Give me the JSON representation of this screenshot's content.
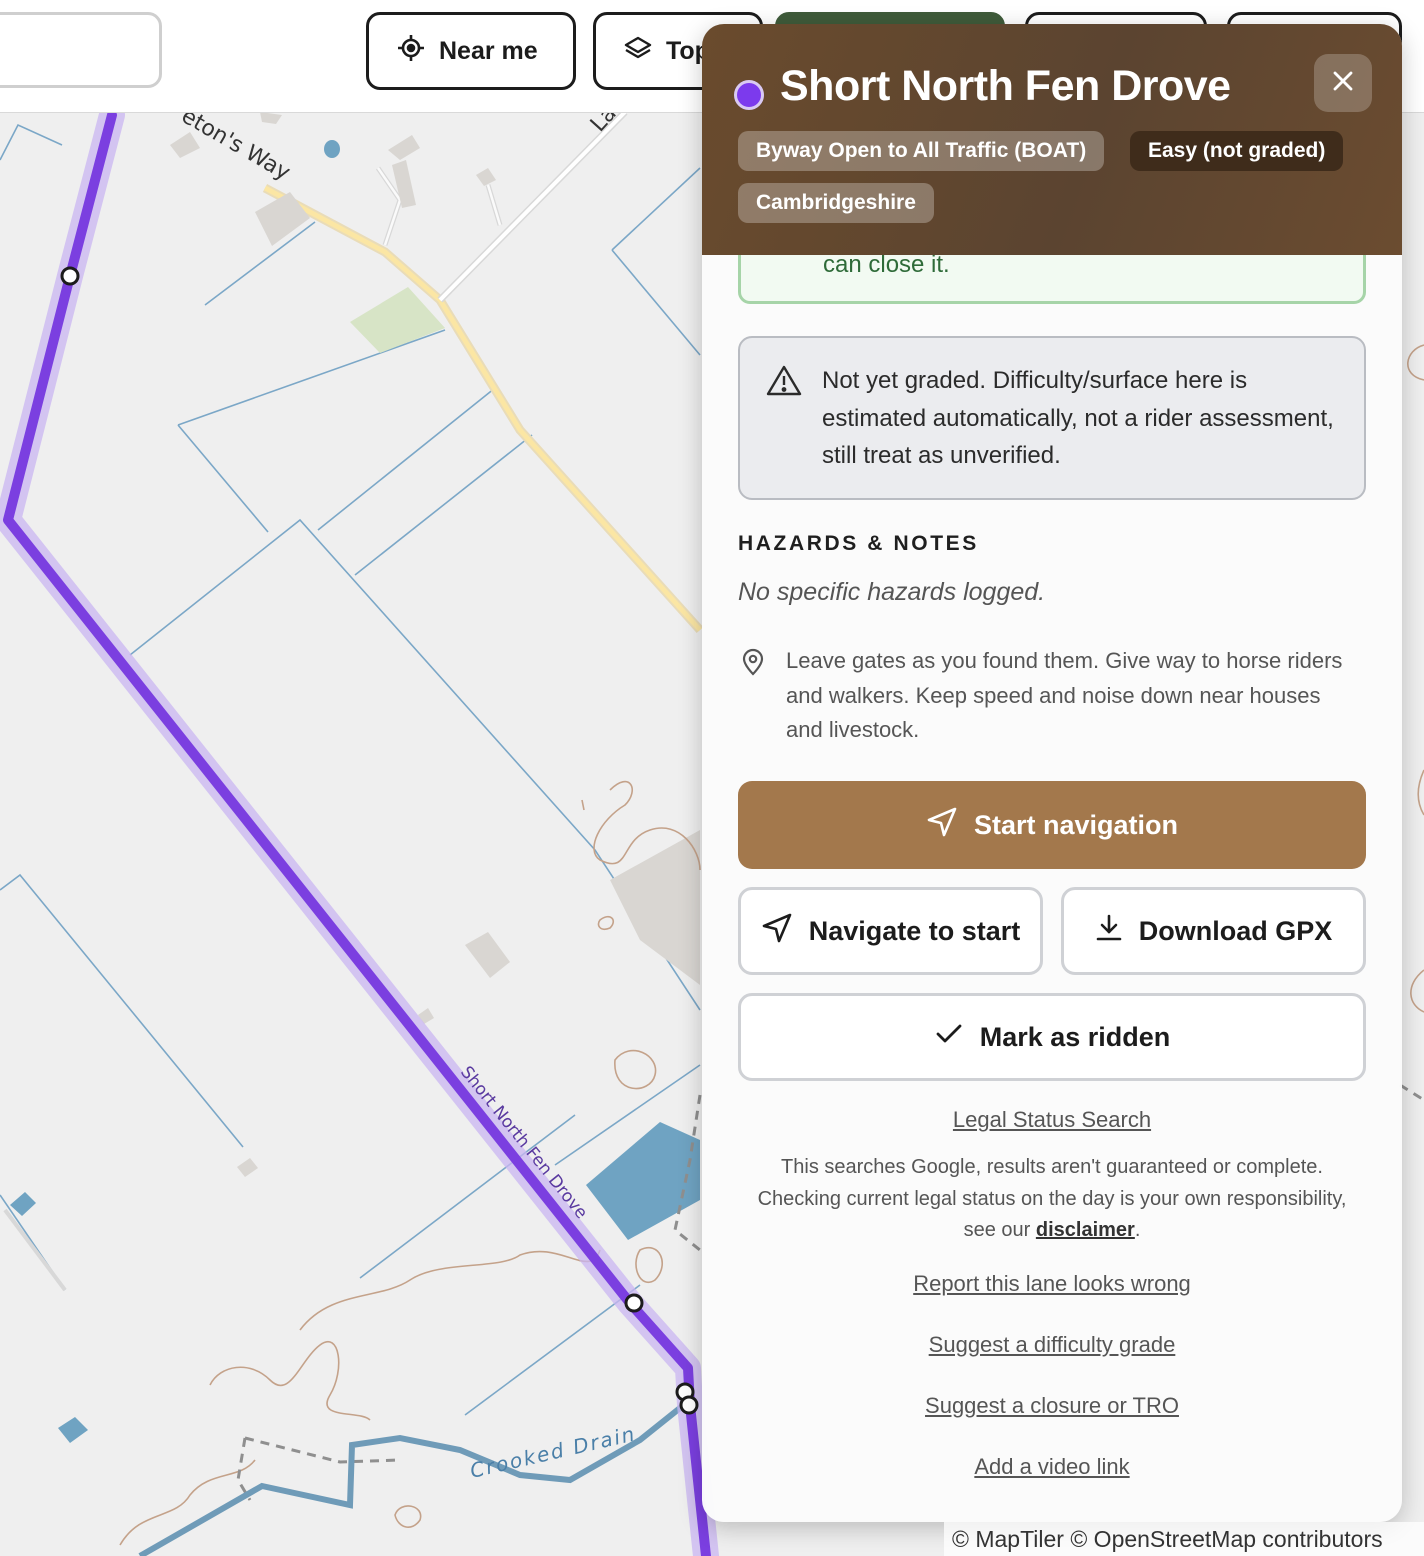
{
  "topbar": {
    "near_me_label": "Near me",
    "layers_label": "Top"
  },
  "panel": {
    "title": "Short North Fen Drove",
    "status_color": "#7c3aed",
    "chips": {
      "designation": "Byway Open to All Traffic (BOAT)",
      "difficulty": "Easy (not graded)",
      "county": "Cambridgeshire"
    },
    "green_note_fragment": "can close it.",
    "grading_notice": "Not yet graded. Difficulty/surface here is estimated automatically, not a rider assessment, still treat as unverified.",
    "hazards_heading": "HAZARDS & NOTES",
    "hazards_empty": "No specific hazards logged.",
    "etiquette": "Leave gates as you found them. Give way to horse riders and walkers. Keep speed and noise down near houses and livestock.",
    "buttons": {
      "start_navigation": "Start navigation",
      "navigate_to_start": "Navigate to start",
      "download_gpx": "Download GPX",
      "mark_as_ridden": "Mark as ridden"
    },
    "legal_status_link": "Legal Status Search",
    "disclaimer_before": "This searches Google, results aren't guaranteed or complete. Checking current legal status on the day is your own responsibility, see our ",
    "disclaimer_link": "disclaimer",
    "disclaimer_after": ".",
    "links": {
      "report_wrong": "Report this lane looks wrong",
      "suggest_grade": "Suggest a difficulty grade",
      "suggest_closure": "Suggest a closure or TRO",
      "add_video": "Add a video link"
    }
  },
  "map": {
    "labels": {
      "road_1": "eton's Way",
      "road_2": "La",
      "drove_label": "Short North Fen Drove",
      "drain_label": "Crooked Drain"
    },
    "route_color": "#7b3fe0",
    "water_color": "#6fa3c2"
  },
  "attribution": "© MapTiler © OpenStreetMap contributors"
}
